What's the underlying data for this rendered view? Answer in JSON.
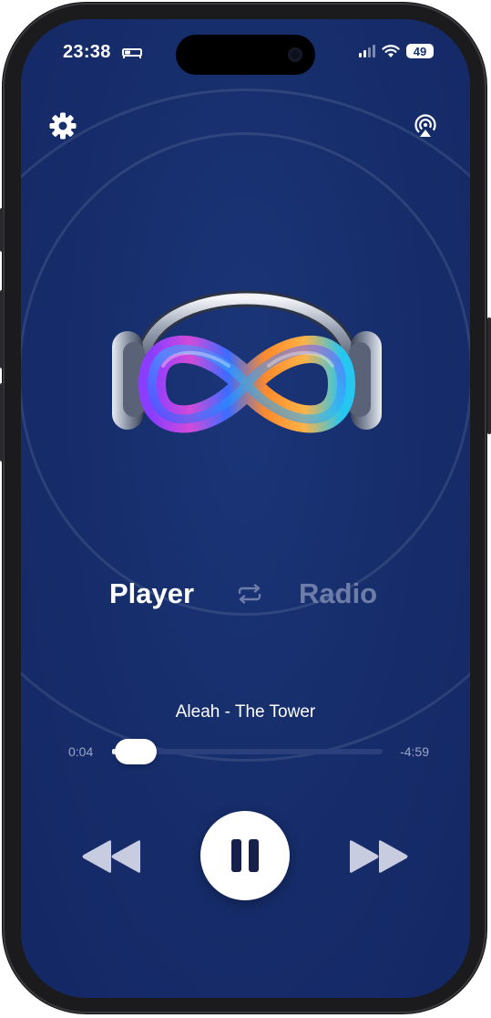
{
  "status_bar": {
    "time": "23:38",
    "battery": "49"
  },
  "header": {
    "settings_icon": "gear-icon",
    "airplay_icon": "airplay-icon"
  },
  "artwork": {
    "logo_icon": "infinity-headphones-logo"
  },
  "mode_tabs": {
    "player_label": "Player",
    "radio_label": "Radio",
    "switch_icon": "repeat-swap-icon",
    "active": "Player"
  },
  "now_playing": {
    "title": "Aleah - The Tower",
    "elapsed": "0:04",
    "remaining": "-4:59",
    "progress_fraction": 0.013
  },
  "controls": {
    "rewind_icon": "rewind-icon",
    "pause_icon": "pause-icon",
    "forward_icon": "fast-forward-icon"
  },
  "colors": {
    "background": "#172e6c",
    "accent": "#ffffff",
    "inactive_tab": "#6e7ca8"
  }
}
